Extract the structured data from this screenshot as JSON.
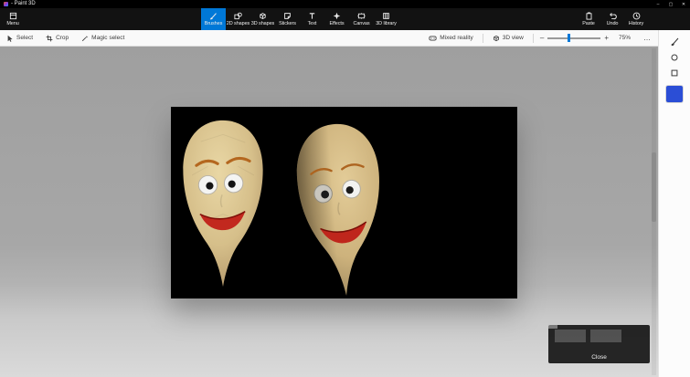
{
  "window": {
    "title": "- Paint 3D",
    "minimize": "–",
    "maximize": "▢",
    "close": "✕"
  },
  "ribbon": {
    "menu": "Menu",
    "tabs": [
      {
        "label": "Brushes",
        "selected": true
      },
      {
        "label": "2D shapes",
        "selected": false
      },
      {
        "label": "3D shapes",
        "selected": false
      },
      {
        "label": "Stickers",
        "selected": false
      },
      {
        "label": "Text",
        "selected": false
      },
      {
        "label": "Effects",
        "selected": false
      },
      {
        "label": "Canvas",
        "selected": false
      },
      {
        "label": "3D library",
        "selected": false
      }
    ],
    "actions": [
      {
        "label": "Paste"
      },
      {
        "label": "Undo"
      },
      {
        "label": "History"
      }
    ]
  },
  "toolbar": {
    "select": "Select",
    "crop": "Crop",
    "magic_select": "Magic select",
    "mixed_reality": "Mixed reality",
    "view_3d": "3D view",
    "zoom_out": "–",
    "zoom_in": "+",
    "zoom_level": "75%",
    "more": "…"
  },
  "overlay": {
    "close": "Close"
  },
  "colors": {
    "accent": "#0078d7",
    "swatch_blue": "#2b4ed6"
  }
}
